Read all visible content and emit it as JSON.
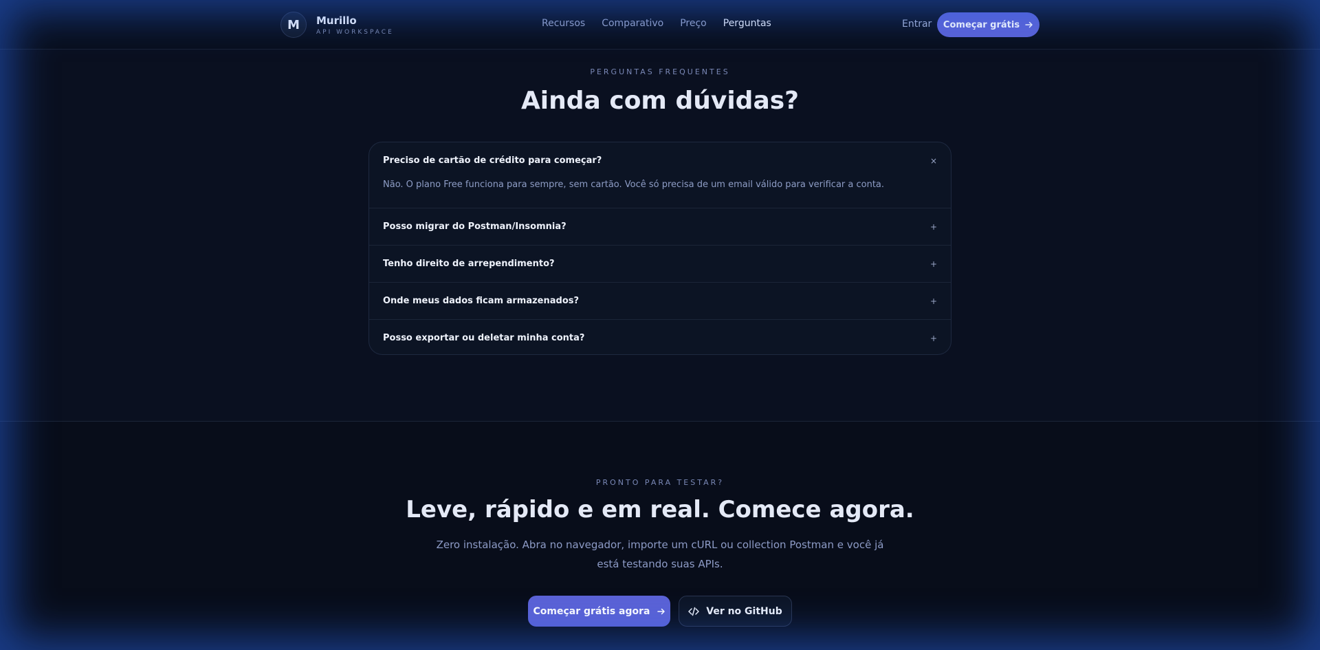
{
  "header": {
    "logo_letter": "M",
    "brand_name": "Murillo",
    "brand_sub": "API WORKSPACE",
    "nav": [
      "Recursos",
      "Comparativo",
      "Preço",
      "Perguntas"
    ],
    "nav_active_index": 3,
    "login_label": "Entrar",
    "cta_label": "Começar grátis"
  },
  "faq_section": {
    "eyebrow": "PERGUNTAS FREQUENTES",
    "title": "Ainda com dúvidas?",
    "items": [
      {
        "question": "Preciso de cartão de crédito para começar?",
        "answer": "Não. O plano Free funciona para sempre, sem cartão. Você só precisa de um email válido para verificar a conta.",
        "open": true,
        "icon": "×"
      },
      {
        "question": "Posso migrar do Postman/Insomnia?",
        "open": false,
        "icon": "+"
      },
      {
        "question": "Tenho direito de arrependimento?",
        "open": false,
        "icon": "+"
      },
      {
        "question": "Onde meus dados ficam armazenados?",
        "open": false,
        "icon": "+"
      },
      {
        "question": "Posso exportar ou deletar minha conta?",
        "open": false,
        "icon": "+"
      }
    ]
  },
  "cta_section": {
    "eyebrow": "PRONTO PARA TESTAR?",
    "title": "Leve, rápido e em real. Comece agora.",
    "description": "Zero instalação. Abra no navegador, importe um cURL ou collection Postman e você já está testando suas APIs.",
    "primary_label": "Começar grátis agora",
    "secondary_label": "Ver no GitHub"
  },
  "colors": {
    "accent": "#5b62d6",
    "background": "#0a1020",
    "glow": "#2864e6"
  },
  "icons": {
    "arrow": "arrow-right-icon",
    "code": "code-icon",
    "close": "close-icon",
    "plus": "plus-icon"
  }
}
